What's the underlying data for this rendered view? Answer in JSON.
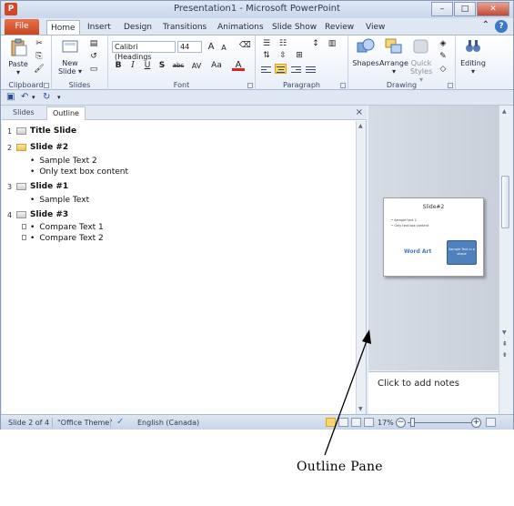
{
  "window": {
    "title": "Presentation1 - Microsoft PowerPoint",
    "app_letter": "P"
  },
  "window_controls": {
    "minimize": "–",
    "maximize": "□",
    "close": "✕"
  },
  "ribbon_tabs": {
    "file": "File",
    "tabs": [
      "Home",
      "Insert",
      "Design",
      "Transitions",
      "Animations",
      "Slide Show",
      "Review",
      "View"
    ],
    "active": "Home"
  },
  "ribbon": {
    "clipboard": {
      "label": "Clipboard",
      "paste": "Paste"
    },
    "slides": {
      "label": "Slides",
      "new_slide_line1": "New",
      "new_slide_line2": "Slide"
    },
    "font": {
      "label": "Font",
      "font_name": "Calibri (Headings",
      "font_size": "44",
      "grow": "A",
      "shrink": "A",
      "bold": "B",
      "italic": "I",
      "underline": "U",
      "shadow": "S",
      "strike": "abc",
      "spacing": "AV",
      "case": "Aa",
      "color": "A"
    },
    "paragraph": {
      "label": "Paragraph"
    },
    "drawing": {
      "label": "Drawing",
      "shapes": "Shapes",
      "arrange": "Arrange",
      "quick_styles_line1": "Quick",
      "quick_styles_line2": "Styles"
    },
    "editing": {
      "label": "Editing"
    }
  },
  "left_pane": {
    "tabs": [
      "Slides",
      "Outline"
    ],
    "active_tab": "Outline",
    "close": "×",
    "outline": [
      {
        "num": "1",
        "title": "Title  Slide",
        "bullets": [],
        "selected": false
      },
      {
        "num": "2",
        "title": "Slide #2",
        "bullets": [
          "Sample Text 2",
          "Only text box content"
        ],
        "selected": true
      },
      {
        "num": "3",
        "title": "Slide  #1",
        "bullets": [
          "Sample Text"
        ],
        "selected": false
      },
      {
        "num": "4",
        "title": "Slide  #3",
        "bullets": [
          "Compare Text 1",
          "Compare Text 2"
        ],
        "selected": false
      }
    ]
  },
  "slide_preview": {
    "title": "Slide#2",
    "bullets": [
      "Sample text 2",
      "Only text box content"
    ],
    "word_art": "Word Art",
    "shape_text": "Sample Text in a shape"
  },
  "notes": {
    "placeholder": "Click to add notes"
  },
  "status_bar": {
    "slide_info": "Slide 2 of 4",
    "theme": "\"Office Theme\"",
    "language": "English (Canada)",
    "zoom": "17%",
    "zoom_out": "−",
    "zoom_in": "+"
  },
  "callout": {
    "label": "Outline Pane"
  },
  "colors": {
    "file_tab": "#d24726",
    "selected_align": "#fbd46b",
    "shape_fill": "#4f81bd",
    "word_art": "#4a77c0"
  }
}
